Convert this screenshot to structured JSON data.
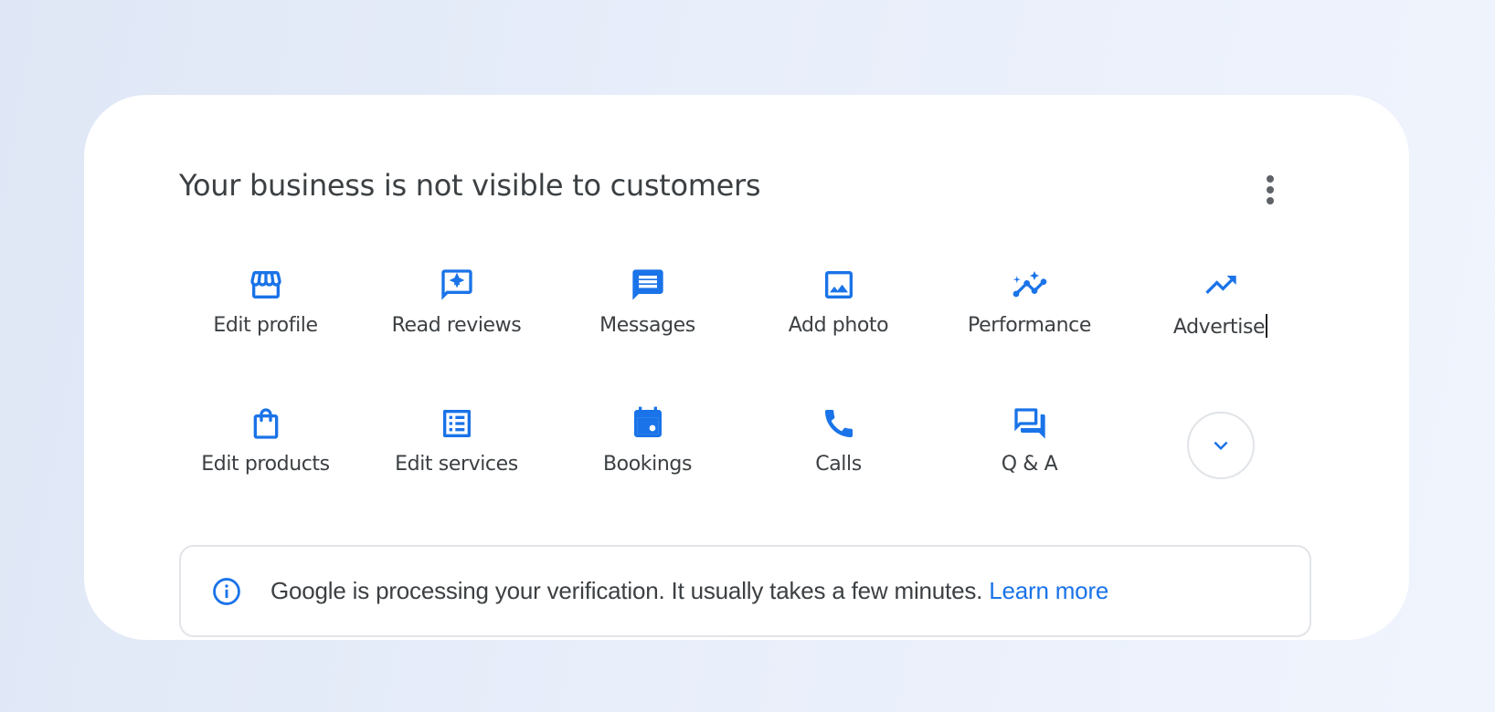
{
  "card": {
    "title": "Your business is not visible to customers",
    "more_menu_icon": "more-vert-icon"
  },
  "actions_row1": [
    {
      "label": "Edit profile",
      "icon": "storefront-icon"
    },
    {
      "label": "Read reviews",
      "icon": "review-star-icon"
    },
    {
      "label": "Messages",
      "icon": "message-icon"
    },
    {
      "label": "Add photo",
      "icon": "image-icon"
    },
    {
      "label": "Performance",
      "icon": "insights-icon"
    },
    {
      "label": "Advertise",
      "icon": "trending-up-icon"
    }
  ],
  "actions_row2": [
    {
      "label": "Edit products",
      "icon": "shopping-bag-icon"
    },
    {
      "label": "Edit services",
      "icon": "list-alt-icon"
    },
    {
      "label": "Bookings",
      "icon": "calendar-icon"
    },
    {
      "label": "Calls",
      "icon": "phone-icon"
    },
    {
      "label": "Q & A",
      "icon": "forum-icon"
    }
  ],
  "expand_button_icon": "chevron-down-icon",
  "notice": {
    "icon": "info-icon",
    "message": "Google is processing your verification. It usually takes a few minutes.",
    "link_label": "Learn more"
  },
  "colors": {
    "accent": "#1a73e8",
    "text": "#3c4043",
    "background": "#e4ebf8",
    "card": "#ffffff"
  }
}
